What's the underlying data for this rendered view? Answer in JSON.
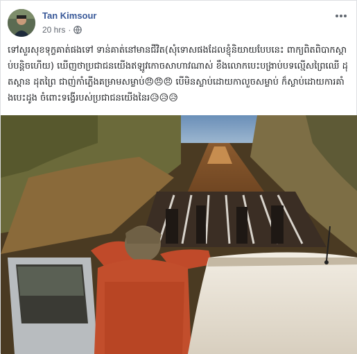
{
  "post": {
    "author": "Tan Kimsour",
    "timestamp": "20 hrs",
    "separator": "·",
    "privacy_icon": "globe-icon",
    "menu_icon": "more-options-icon",
    "text": "ទៅសួរសុខទុក្ខគាត់ផងទៅ ទាន់គាត់នៅមានជីវិត(សុំទោសផងដែលខ្ញុំនិយាយបែបនេះ ពាក្យពិតពិបាកស្តាប់បន្តិចហើយ) ឃើញថាប្រជាជនយើងឥឡូវកោចសាហាវណាស់ ខឹងលោកបេះបង្រាប់បទល្មើសព្រៃឈើ ដុតស្ពាន ដុតព្រៃ ជាញ់កាំភ្លើងគម្រាមសម្លាប់😠😠😠 បើមិនស្លាប់ដោយកាលួចសម្លាប់ ក៏ស្លាប់ដោយការគាំងបេះដូង ចំពោះទង្វើរបស់ប្រជាជនយើងនៃរ😥😥😥",
    "photo_icon": "post-photo"
  }
}
